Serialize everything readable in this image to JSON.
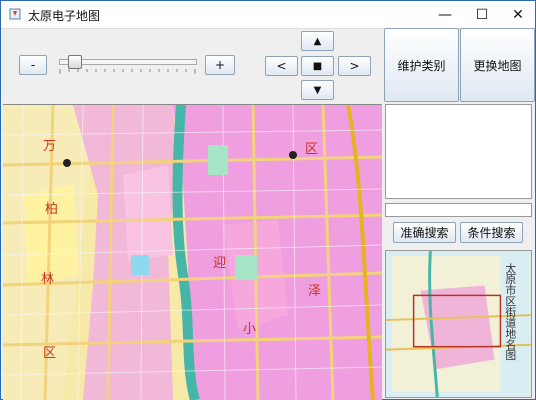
{
  "window": {
    "title": "太原电子地图",
    "controls": {
      "minimize": "—",
      "maximize": "☐",
      "close": "✕"
    }
  },
  "zoom": {
    "minus_label": "-",
    "plus_label": "+",
    "level_fraction": 0.07
  },
  "pan": {
    "up": "▲",
    "left": "<",
    "center": "■",
    "right": ">",
    "down": "▼"
  },
  "actions": {
    "maintain_category": "维护类别",
    "change_map": "更换地图",
    "exact_search": "准确搜索",
    "conditional_search": "条件搜索"
  },
  "search": {
    "value": ""
  },
  "map": {
    "labels": [
      "万",
      "柏",
      "林",
      "区",
      "迎",
      "泽",
      "区",
      "小"
    ]
  },
  "overview": {
    "title": "太原市区街道地名图"
  }
}
